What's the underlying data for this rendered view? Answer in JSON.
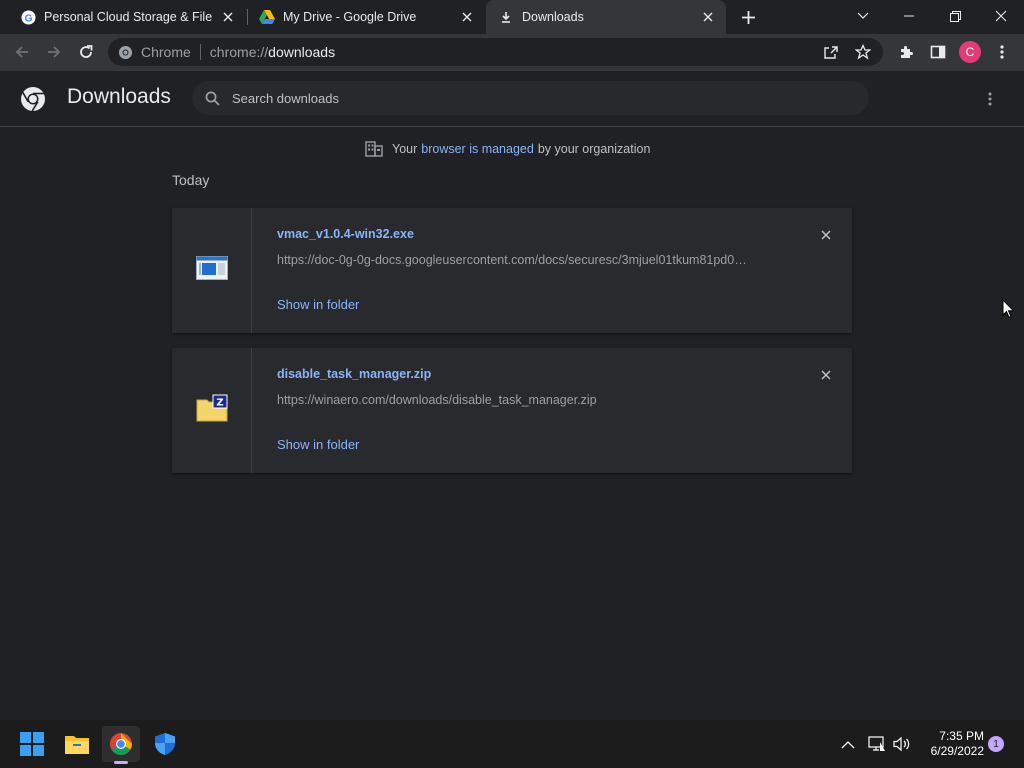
{
  "tabs": [
    {
      "title": "Personal Cloud Storage & File Sh",
      "icon": "google-g-icon",
      "active": false
    },
    {
      "title": "My Drive - Google Drive",
      "icon": "google-drive-icon",
      "active": false
    },
    {
      "title": "Downloads",
      "icon": "download-icon",
      "active": true
    }
  ],
  "omnibox": {
    "chip": "Chrome",
    "scheme": "chrome://",
    "host": "downloads"
  },
  "profile": {
    "initial": "C",
    "color": "#e33b78"
  },
  "downloads_page": {
    "title": "Downloads",
    "search_placeholder": "Search downloads",
    "managed": {
      "before": "Your",
      "link": "browser is managed",
      "after": "by your organization"
    },
    "date_header": "Today",
    "items": [
      {
        "filename": "vmac_v1.0.4-win32.exe",
        "url": "https://doc-0g-0g-docs.googleusercontent.com/docs/securesc/3mjuel01tkum81pd0…",
        "action": "Show in folder",
        "icon": "exe-file-icon"
      },
      {
        "filename": "disable_task_manager.zip",
        "url": "https://winaero.com/downloads/disable_task_manager.zip",
        "action": "Show in folder",
        "icon": "zip-file-icon"
      }
    ]
  },
  "taskbar": {
    "apps": [
      "windows-start-icon",
      "file-explorer-icon",
      "chrome-icon",
      "windows-security-icon"
    ],
    "clock": {
      "time": "7:35 PM",
      "date": "6/29/2022"
    },
    "notifications": "1"
  },
  "colors": {
    "accent": "#8ab4f8",
    "background": "#202124",
    "card": "#292a2d",
    "toolbar": "#35363a"
  }
}
